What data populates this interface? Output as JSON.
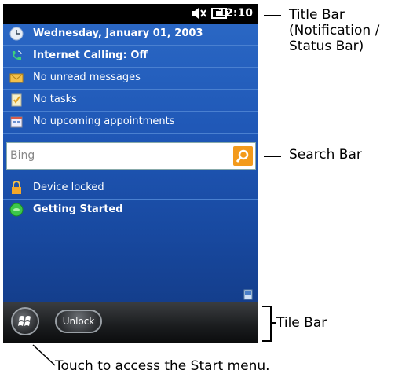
{
  "status": {
    "time": "12:10"
  },
  "today": {
    "date": "Wednesday, January 01, 2003",
    "internet_calling": "Internet Calling: Off",
    "messages": "No unread messages",
    "tasks": "No tasks",
    "appointments": "No upcoming appointments",
    "device_locked": "Device locked",
    "getting_started": "Getting Started"
  },
  "search": {
    "value": "Bing"
  },
  "tilebar": {
    "unlock_label": "Unlock"
  },
  "callouts": {
    "title_bar": [
      "Title Bar",
      "(Notification /",
      "Status Bar)"
    ],
    "search_bar": "Search Bar",
    "tile_bar": "Tile Bar",
    "start_menu": "Touch to access the Start menu."
  },
  "colors": {
    "today_bg": "#1f57b6",
    "search_button": "#f39a1b"
  }
}
